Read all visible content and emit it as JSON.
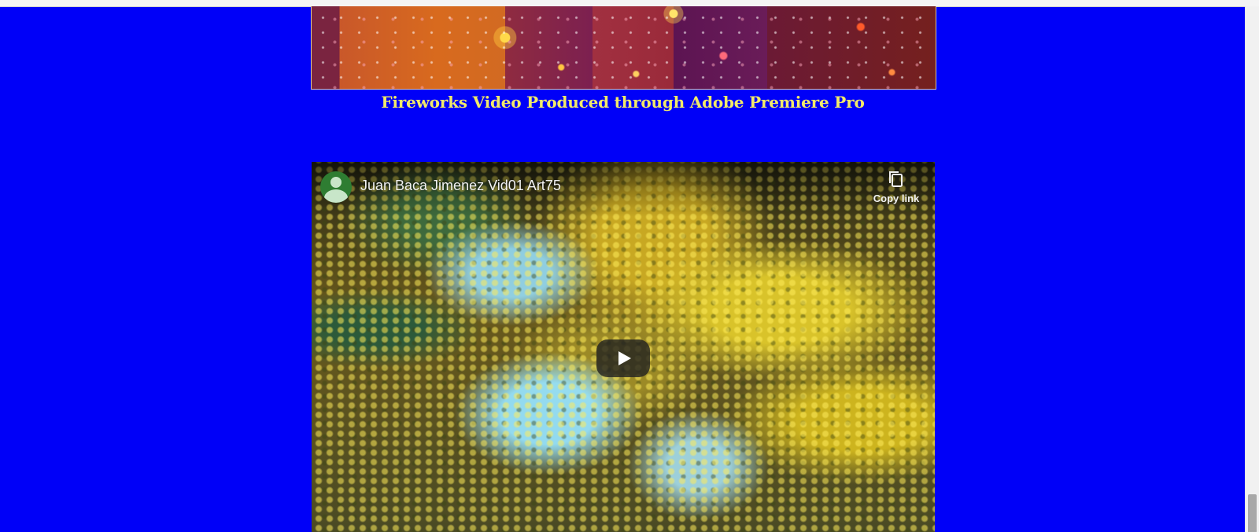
{
  "fireworks_section": {
    "caption": "Fireworks Video Produced through Adobe Premiere Pro"
  },
  "video_embed": {
    "title": "Juan Baca Jimenez Vid01 Art75",
    "copy_link_label": "Copy link",
    "icons": {
      "avatar": "channel-avatar-icon",
      "copy": "copy-icon",
      "play": "play-icon"
    }
  },
  "colors": {
    "page_background": "#0000f8",
    "caption_text": "#f2ea6a",
    "avatar_background": "#2e7d32"
  }
}
